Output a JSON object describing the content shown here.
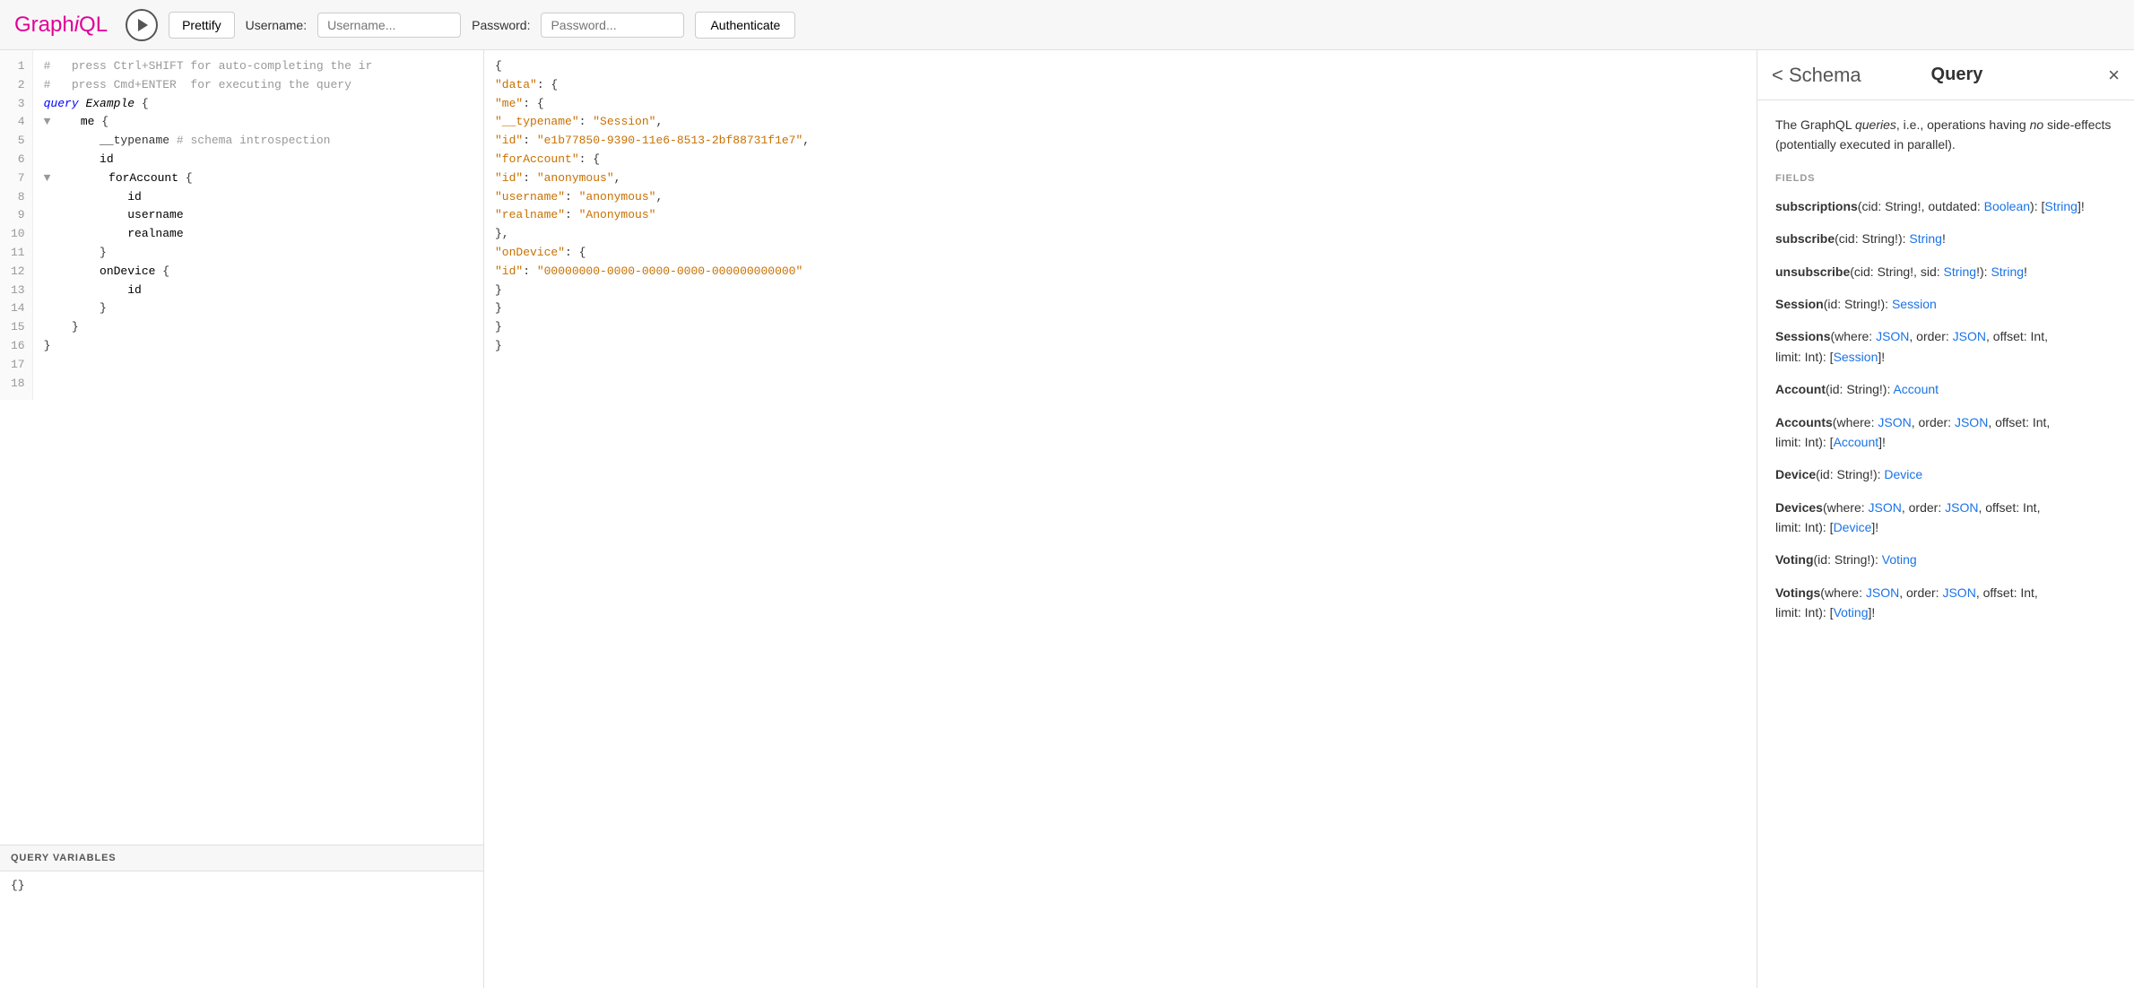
{
  "header": {
    "logo_text": "Graph",
    "logo_italic": "i",
    "logo_rest": "QL",
    "prettify_label": "Prettify",
    "username_label": "Username:",
    "username_placeholder": "Username...",
    "password_label": "Password:",
    "password_placeholder": "Password...",
    "authenticate_label": "Authenticate"
  },
  "editor": {
    "lines": [
      {
        "num": 1,
        "content": "#   press Ctrl+SHIFT for auto-completing the ir",
        "type": "comment"
      },
      {
        "num": 2,
        "content": "#   press Cmd+ENTER  for executing the query",
        "type": "comment"
      },
      {
        "num": 3,
        "content": "",
        "type": "empty"
      },
      {
        "num": 4,
        "content": "query Example {",
        "type": "query"
      },
      {
        "num": 5,
        "content": "    me {",
        "type": "field",
        "fold": true
      },
      {
        "num": 6,
        "content": "        __typename # schema introspection",
        "type": "field"
      },
      {
        "num": 7,
        "content": "        id",
        "type": "field"
      },
      {
        "num": 8,
        "content": "        forAccount {",
        "type": "field",
        "fold": true
      },
      {
        "num": 9,
        "content": "            id",
        "type": "field"
      },
      {
        "num": 10,
        "content": "            username",
        "type": "field"
      },
      {
        "num": 11,
        "content": "            realname",
        "type": "field"
      },
      {
        "num": 12,
        "content": "        }",
        "type": "brace"
      },
      {
        "num": 13,
        "content": "        onDevice {",
        "type": "field",
        "fold": false
      },
      {
        "num": 14,
        "content": "            id",
        "type": "field"
      },
      {
        "num": 15,
        "content": "        }",
        "type": "brace"
      },
      {
        "num": 16,
        "content": "    }",
        "type": "brace"
      },
      {
        "num": 17,
        "content": "}",
        "type": "brace"
      },
      {
        "num": 18,
        "content": "",
        "type": "empty"
      }
    ]
  },
  "variables": {
    "header": "QUERY VARIABLES",
    "content": "{}"
  },
  "response": {
    "lines": [
      {
        "text": "{",
        "type": "brace"
      },
      {
        "text": "  \"data\": {",
        "type": "key-open",
        "key": "data"
      },
      {
        "text": "    \"me\": {",
        "type": "key-open",
        "key": "me"
      },
      {
        "text": "      \"__typename\": \"Session\",",
        "type": "kv",
        "key": "__typename",
        "value": "Session"
      },
      {
        "text": "      \"id\": \"e1b77850-9390-11e6-8513-2bf88731f1e7\",",
        "type": "kv",
        "key": "id",
        "value": "e1b77850-9390-11e6-8513-2bf88731f1e7"
      },
      {
        "text": "      \"forAccount\": {",
        "type": "key-open",
        "key": "forAccount"
      },
      {
        "text": "        \"id\": \"anonymous\",",
        "type": "kv",
        "key": "id",
        "value": "anonymous"
      },
      {
        "text": "        \"username\": \"anonymous\",",
        "type": "kv",
        "key": "username",
        "value": "anonymous"
      },
      {
        "text": "        \"realname\": \"Anonymous\"",
        "type": "kv",
        "key": "realname",
        "value": "Anonymous"
      },
      {
        "text": "      },",
        "type": "brace"
      },
      {
        "text": "      \"onDevice\": {",
        "type": "key-open",
        "key": "onDevice"
      },
      {
        "text": "        \"id\": \"00000000-0000-0000-0000-000000000000\"",
        "type": "kv",
        "key": "id",
        "value": "00000000-0000-0000-0000-000000000000"
      },
      {
        "text": "      }",
        "type": "brace"
      },
      {
        "text": "    }",
        "type": "brace"
      },
      {
        "text": "  }",
        "type": "brace"
      },
      {
        "text": "}",
        "type": "brace"
      }
    ]
  },
  "docs": {
    "back_label": "< Schema",
    "title": "Query",
    "close_symbol": "×",
    "description_parts": [
      {
        "text": "The GraphQL ",
        "em": false
      },
      {
        "text": "queries",
        "em": true
      },
      {
        "text": ", i.e., operations having ",
        "em": false
      },
      {
        "text": "no",
        "em": true
      },
      {
        "text": " side-effects (potentially executed in parallel).",
        "em": false
      }
    ],
    "fields_label": "FIELDS",
    "fields": [
      {
        "name": "subscriptions",
        "args": "(cid: String!, outdated: Boolean)",
        "return_prefix": ": [",
        "return_type": "String",
        "return_suffix": "]!"
      },
      {
        "name": "subscribe",
        "args": "(cid: String!)",
        "return_prefix": ": ",
        "return_type": "String",
        "return_suffix": "!"
      },
      {
        "name": "unsubscribe",
        "args": "(cid: String!, sid: ",
        "args2_type": "String",
        "args2_suffix": "!): ",
        "return_type": "String",
        "return_suffix": "!",
        "complex": true
      },
      {
        "name": "Session",
        "args": "(id: String!)",
        "return_prefix": ": ",
        "return_type": "Session",
        "return_suffix": ""
      },
      {
        "name": "Sessions",
        "args": "(where: JSON, order: JSON, offset: Int,\nlimit: Int)",
        "return_prefix": ": [",
        "return_type": "Session",
        "return_suffix": "]!",
        "multiline": true
      },
      {
        "name": "Account",
        "args": "(id: String!)",
        "return_prefix": ": ",
        "return_type": "Account",
        "return_suffix": ""
      },
      {
        "name": "Accounts",
        "args": "(where: JSON, order: JSON, offset: Int,\nlimit: Int)",
        "return_prefix": ": [",
        "return_type": "Account",
        "return_suffix": "]!",
        "multiline": true
      },
      {
        "name": "Device",
        "args": "(id: String!)",
        "return_prefix": ": ",
        "return_type": "Device",
        "return_suffix": ""
      },
      {
        "name": "Devices",
        "args": "(where: JSON, order: JSON, offset: Int,\nlimit: Int)",
        "return_prefix": ": [",
        "return_type": "Device",
        "return_suffix": "]!",
        "multiline": true
      },
      {
        "name": "Voting",
        "args": "(id: String!)",
        "return_prefix": ": ",
        "return_type": "Voting",
        "return_suffix": ""
      },
      {
        "name": "Votings",
        "args": "(where: JSON, order: JSON, offset: Int,\nlimit: Int)",
        "return_prefix": ": [",
        "return_type": "Voting",
        "return_suffix": "]!",
        "multiline": true,
        "partial": true
      }
    ]
  }
}
